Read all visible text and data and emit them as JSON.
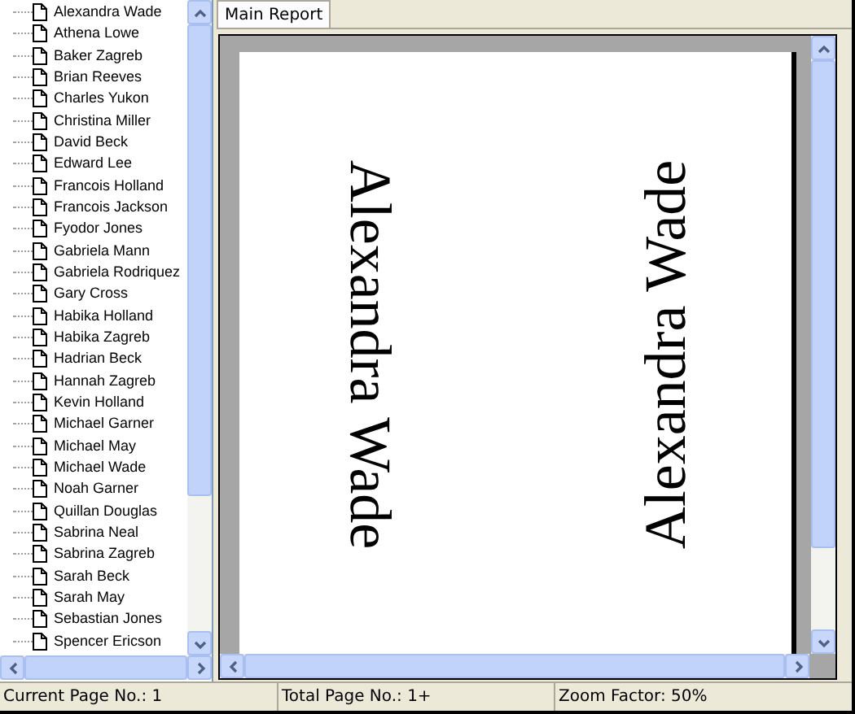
{
  "tree": {
    "items": [
      {
        "label": "Alexandra Wade"
      },
      {
        "label": "Athena Lowe"
      },
      {
        "label": "Baker Zagreb"
      },
      {
        "label": "Brian Reeves"
      },
      {
        "label": "Charles Yukon"
      },
      {
        "label": "Christina Miller"
      },
      {
        "label": "David Beck"
      },
      {
        "label": "Edward Lee"
      },
      {
        "label": "Francois Holland"
      },
      {
        "label": "Francois Jackson"
      },
      {
        "label": "Fyodor Jones"
      },
      {
        "label": "Gabriela Mann"
      },
      {
        "label": "Gabriela Rodriquez"
      },
      {
        "label": "Gary Cross"
      },
      {
        "label": "Habika Holland"
      },
      {
        "label": "Habika Zagreb"
      },
      {
        "label": "Hadrian Beck"
      },
      {
        "label": "Hannah Zagreb"
      },
      {
        "label": "Kevin Holland"
      },
      {
        "label": "Michael Garner"
      },
      {
        "label": "Michael May"
      },
      {
        "label": "Michael Wade"
      },
      {
        "label": "Noah Garner"
      },
      {
        "label": "Quillan Douglas"
      },
      {
        "label": "Sabrina Neal"
      },
      {
        "label": "Sabrina Zagreb"
      },
      {
        "label": "Sarah Beck"
      },
      {
        "label": "Sarah May"
      },
      {
        "label": "Sebastian Jones"
      },
      {
        "label": "Spencer Ericson"
      }
    ]
  },
  "tabs": [
    {
      "label": "Main Report",
      "selected": true
    }
  ],
  "page": {
    "texts": [
      {
        "text": "Alexandra Wade",
        "kind": "down"
      },
      {
        "text": "Alexandra Wade",
        "kind": "up"
      }
    ]
  },
  "status_bar": [
    "Current Page No.: 1",
    "Total Page No.: 1+",
    "Zoom Factor: 50%"
  ]
}
